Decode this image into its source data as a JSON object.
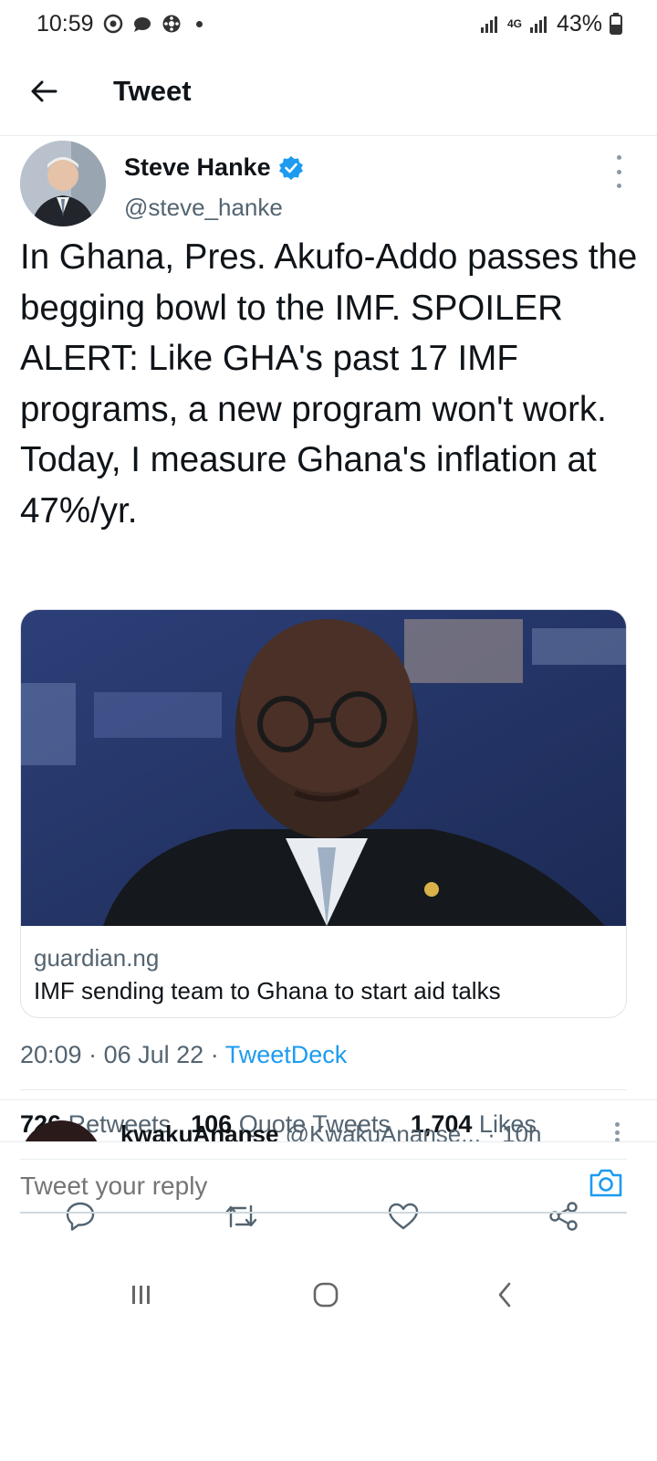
{
  "status_bar": {
    "time": "10:59",
    "network": "4G",
    "battery": "43%"
  },
  "header": {
    "title": "Tweet"
  },
  "tweet": {
    "author_name": "Steve Hanke",
    "author_handle": "@steve_hanke",
    "verified": true,
    "text": "In Ghana, Pres. Akufo-Addo passes the begging bowl to the IMF. SPOILER ALERT: Like GHA's past 17 IMF programs, a new program won't work. Today, I measure Ghana's inflation at 47%/yr.",
    "card": {
      "domain": "guardian.ng",
      "title": "IMF sending team to Ghana to start aid talks"
    },
    "time": "20:09",
    "date": "06 Jul 22",
    "source": "TweetDeck",
    "stats": {
      "retweets_count": "726",
      "retweets_label": "Retweets",
      "quotes_count": "106",
      "quotes_label": "Quote Tweets",
      "likes_count": "1,704",
      "likes_label": "Likes"
    },
    "actions": [
      "reply-icon",
      "retweet-icon",
      "like-icon",
      "share-icon"
    ]
  },
  "reply_preview": {
    "name": "kwakuAnanse",
    "handle": "@KwakuAnanse...",
    "time": "10h"
  },
  "compose": {
    "placeholder": "Tweet your reply"
  },
  "colors": {
    "accent": "#1d9bf0",
    "text": "#0f1419",
    "secondary": "#536471"
  }
}
